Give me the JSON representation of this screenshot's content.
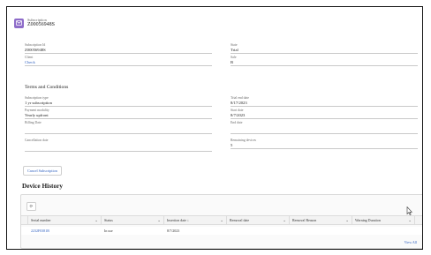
{
  "record": {
    "type_label": "Subscription",
    "name": "Z00056948S"
  },
  "fields": {
    "subscription_id": {
      "label": "Subscription Id",
      "value": "Z00056948S"
    },
    "state": {
      "label": "State",
      "value": "Trial"
    },
    "client": {
      "label": "Client",
      "value": "Check"
    },
    "sale": {
      "label": "Sale",
      "value": "B"
    },
    "subscription_type": {
      "label": "Subscription type",
      "value": "1 yr subscription"
    },
    "trial_end_date": {
      "label": "Trial end date",
      "value": "8/17/2023"
    },
    "payment_modality": {
      "label": "Payment modality",
      "value": "Yearly upfront"
    },
    "start_date": {
      "label": "Start date",
      "value": "8/7/2023"
    },
    "billing_date": {
      "label": "Billing Date",
      "value": ""
    },
    "end_date": {
      "label": "End date",
      "value": ""
    },
    "cancellation_date": {
      "label": "Cancellation date",
      "value": ""
    },
    "remaining_devices": {
      "label": "Remaining devices",
      "value": "5"
    }
  },
  "section": {
    "terms_title": "Terms and Conditions"
  },
  "actions": {
    "cancel_subscription": "Cancel Subscription"
  },
  "device_history": {
    "title": "Device History",
    "refresh_icon": "refresh-icon",
    "columns": [
      {
        "label": "Serial number"
      },
      {
        "label": "Status"
      },
      {
        "label": "Insertion date ↓"
      },
      {
        "label": "Removal date"
      },
      {
        "label": "Removal Reason"
      },
      {
        "label": "Warning Duration"
      }
    ],
    "rows": [
      {
        "serial": "2232F0381B",
        "status": "In use",
        "insertion_date": "8/7/2023",
        "removal_date": "",
        "removal_reason": "",
        "warning_duration": ""
      }
    ],
    "view_all": "View All"
  },
  "colors": {
    "accent_purple": "#8e6cc9",
    "link_blue": "#2d5fbf"
  }
}
